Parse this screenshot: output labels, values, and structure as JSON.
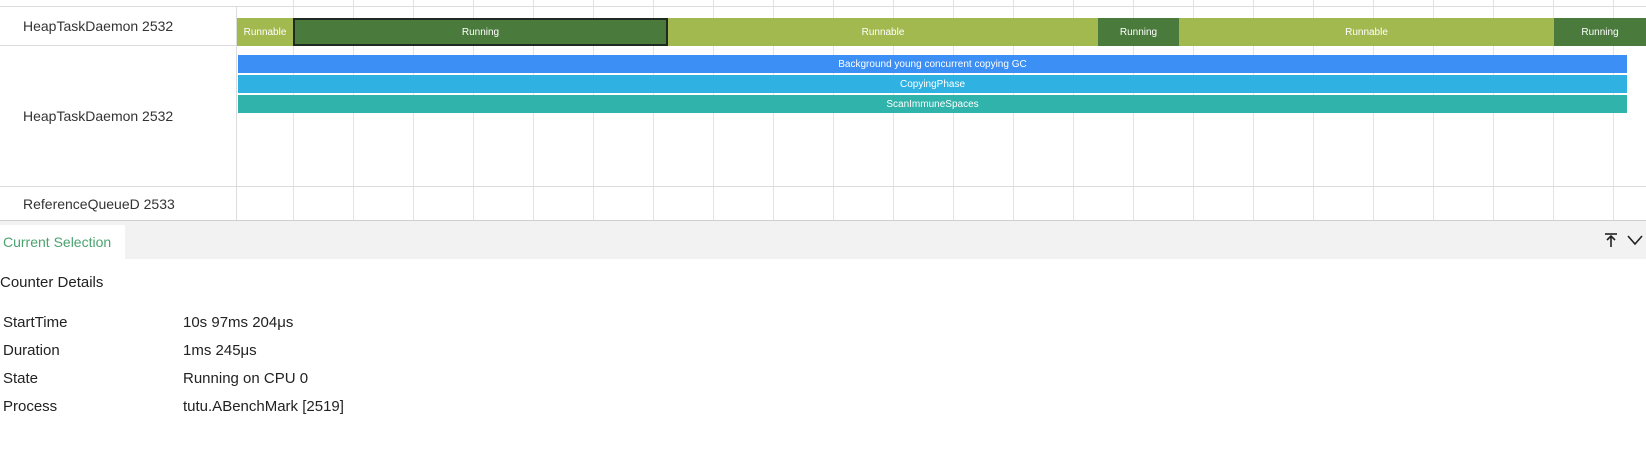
{
  "tracks": {
    "thread_state_row": {
      "label": "HeapTaskDaemon 2532"
    },
    "slice_row": {
      "label": "HeapTaskDaemon 2532"
    },
    "reference_row": {
      "label": "ReferenceQueueD 2533"
    }
  },
  "states": [
    {
      "label": "Runnable",
      "color": "#a2b94f"
    },
    {
      "label": "Running",
      "color": "#4a7a3c",
      "selected": true
    },
    {
      "label": "Runnable",
      "color": "#a2b94f"
    },
    {
      "label": "Running",
      "color": "#4a7a3c"
    },
    {
      "label": "Runnable",
      "color": "#a2b94f"
    },
    {
      "label": "Running",
      "color": "#4a7a3c"
    }
  ],
  "slices": [
    {
      "label": "Background young concurrent copying GC",
      "color": "#3c8ff5"
    },
    {
      "label": "CopyingPhase",
      "color": "#2fb2e2"
    },
    {
      "label": "ScanImmuneSpaces",
      "color": "#2fb3aa"
    }
  ],
  "panel": {
    "tab_label": "Current Selection",
    "pin_icon": "pin-top-icon",
    "collapse_icon": "chevron-down-icon",
    "details_title": "Counter Details",
    "details": [
      {
        "key": "StartTime",
        "value": "10s 97ms 204μs"
      },
      {
        "key": "Duration",
        "value": "1ms 245μs"
      },
      {
        "key": "State",
        "value": "Running on CPU 0"
      },
      {
        "key": "Process",
        "value": "tutu.ABenchMark [2519]"
      }
    ]
  }
}
